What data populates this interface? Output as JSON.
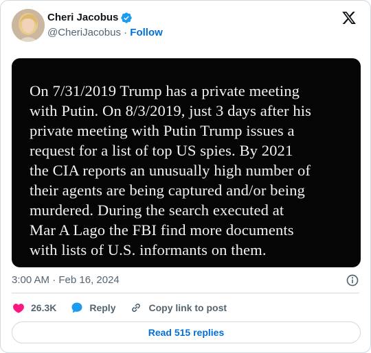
{
  "author": {
    "name": "Cheri Jacobus",
    "handle": "@CheriJacobus",
    "separator": " · ",
    "follow_label": "Follow"
  },
  "media": {
    "text": "On  7/31/2019 Trump has a private meeting\nwith Putin. On 8/3/2019, just 3 days after his\nprivate meeting with Putin Trump issues a\nrequest for a list of top US spies. By 2021\nthe CIA reports an unusually high number of\ntheir agents are being captured and/or being\nmurdered.  During the search executed at\nMar A Lago the FBI find more documents\nwith lists of U.S. informants on them."
  },
  "timestamp": "3:00 AM · Feb 16, 2024",
  "actions": {
    "likes": "26.3K",
    "reply_label": "Reply",
    "copy_label": "Copy link to post"
  },
  "read_replies_label": "Read 515 replies",
  "colors": {
    "link": "#006fd6",
    "heart": "#f91880",
    "reply": "#1d9bf0",
    "muted": "#536471",
    "border": "#cfd9de"
  },
  "icons": [
    "verified-badge-icon",
    "x-logo-icon",
    "info-icon",
    "heart-icon",
    "reply-bubble-icon",
    "link-icon"
  ]
}
